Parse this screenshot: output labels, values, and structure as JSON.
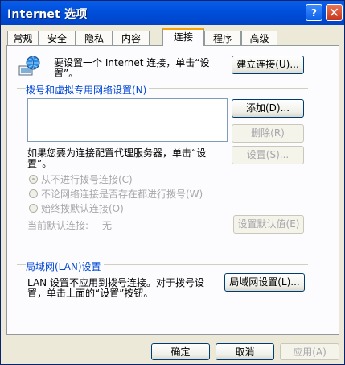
{
  "window": {
    "title": "Internet 选项"
  },
  "titlebar": {
    "help_label": "?",
    "close_label": "✕"
  },
  "tabs": [
    {
      "label": "常规"
    },
    {
      "label": "安全"
    },
    {
      "label": "隐私"
    },
    {
      "label": "内容"
    },
    {
      "label": "连接"
    },
    {
      "label": "程序"
    },
    {
      "label": "高级"
    }
  ],
  "connection": {
    "setup_text_line1": "要设置一个 Internet 连接，单击“设",
    "setup_text_line2": "置”。",
    "setup_button": "建立连接(U)..."
  },
  "dialup": {
    "group_label": "拨号和虚拟专用网络设置(N)",
    "add_button": "添加(D)...",
    "delete_button": "删除(R)",
    "settings_text": "如果您要为连接配置代理服务器，单击“设",
    "settings_text2": "置”。",
    "settings_button": "设置(S)...",
    "radio_never": "从不进行拨号连接(C)",
    "radio_when_no_network": "不论网络连接是否存在都进行拨号(W)",
    "radio_always": "始终拨默认连接(O)",
    "current_default_label": "当前默认连接:",
    "current_default_value": "无",
    "set_default_button": "设置默认值(E)"
  },
  "lan": {
    "group_label": "局域网(LAN)设置",
    "text_line1": "LAN 设置不应用到拨号连接。对于拨号设",
    "text_line2": "置，单击上面的“设置”按钮。",
    "button": "局域网设置(L)..."
  },
  "footer": {
    "ok": "确定",
    "cancel": "取消",
    "apply": "应用(A)"
  }
}
